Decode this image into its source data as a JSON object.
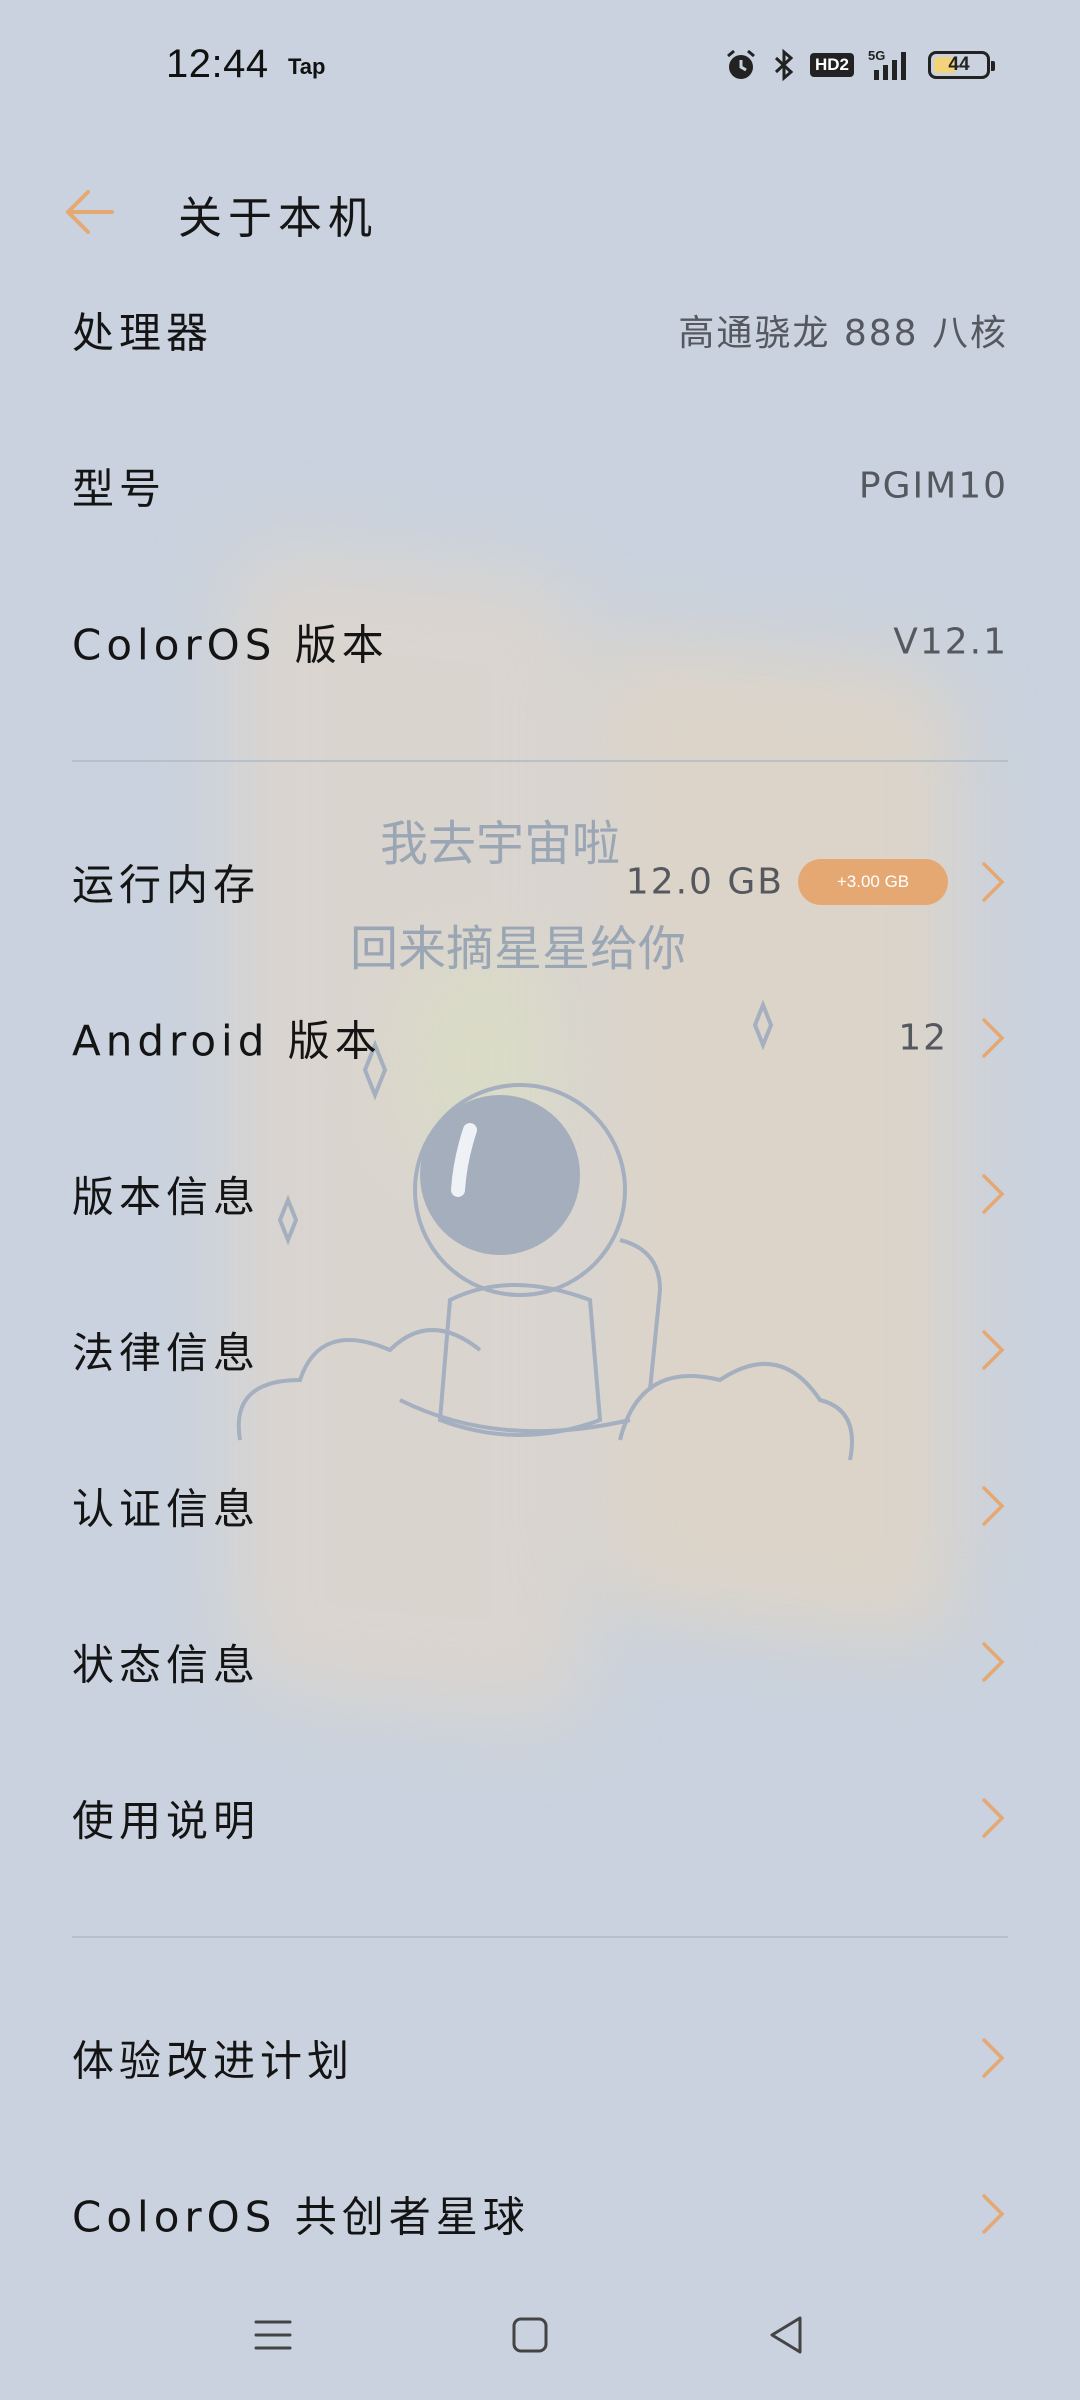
{
  "status_bar": {
    "time": "12:44",
    "app_tag": "Tap",
    "hd_label": "HD2",
    "network": "5G",
    "battery": "44"
  },
  "header": {
    "title": "关于本机"
  },
  "section1": [
    {
      "label": "处理器",
      "value": "高通骁龙 888 八核"
    },
    {
      "label": "型号",
      "value": "PGIM10"
    },
    {
      "label": "ColorOS 版本",
      "value": "V12.1"
    }
  ],
  "section2": [
    {
      "label": "运行内存",
      "value": "12.0 GB",
      "badge": "+3.00 GB"
    },
    {
      "label": "Android 版本",
      "value": "12"
    },
    {
      "label": "版本信息"
    },
    {
      "label": "法律信息"
    },
    {
      "label": "认证信息"
    },
    {
      "label": "状态信息"
    },
    {
      "label": "使用说明"
    }
  ],
  "section3": [
    {
      "label": "体验改进计划"
    },
    {
      "label": "ColorOS 共创者星球"
    }
  ],
  "wallpaper_text": [
    "我去宇宙啦",
    "回来摘星星给你"
  ],
  "colors": {
    "accent": "#e5a873",
    "background": "#c9d2de"
  },
  "icons": [
    "back-arrow-icon",
    "chevron-right-icon",
    "alarm-icon",
    "bluetooth-icon",
    "signal-icon",
    "battery-icon",
    "menu-icon",
    "home-icon",
    "back-icon"
  ]
}
